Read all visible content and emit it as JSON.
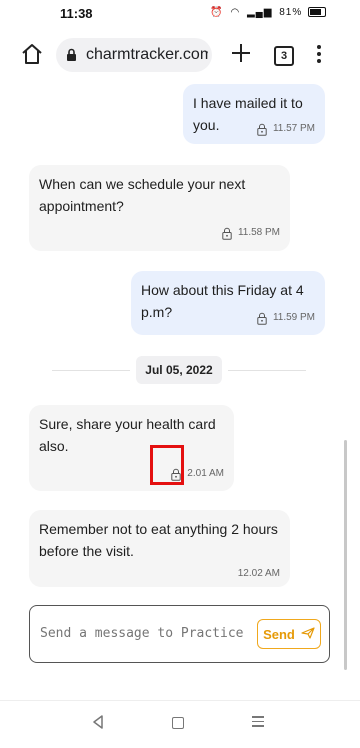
{
  "status_bar": {
    "time": "11:38",
    "battery": "81%"
  },
  "browser": {
    "url": "charmtracker.com",
    "tab_count": "3"
  },
  "messages": [
    {
      "direction": "out",
      "text": "I have mailed it to you.",
      "time": "11.57 PM"
    },
    {
      "direction": "in",
      "text": "When can we schedule your next appointment?",
      "time": "11.58 PM"
    },
    {
      "direction": "out",
      "text": "How about this Friday at 4 p.m?",
      "time": "11.59 PM"
    },
    {
      "direction": "in",
      "text": "Sure, share your health card also.",
      "time": "2.01 AM"
    },
    {
      "direction": "in",
      "text": "Remember not to eat anything 2 hours before the visit.",
      "time": "12.02 AM"
    }
  ],
  "date_separator": "Jul 05, 2022",
  "composer": {
    "placeholder": "Send a message to Practice",
    "send_label": "Send"
  },
  "colors": {
    "send_accent": "#f0a81d",
    "outgoing_bubble": "#e9f0fd",
    "incoming_bubble": "#f5f5f5",
    "highlight": "#e41010"
  }
}
